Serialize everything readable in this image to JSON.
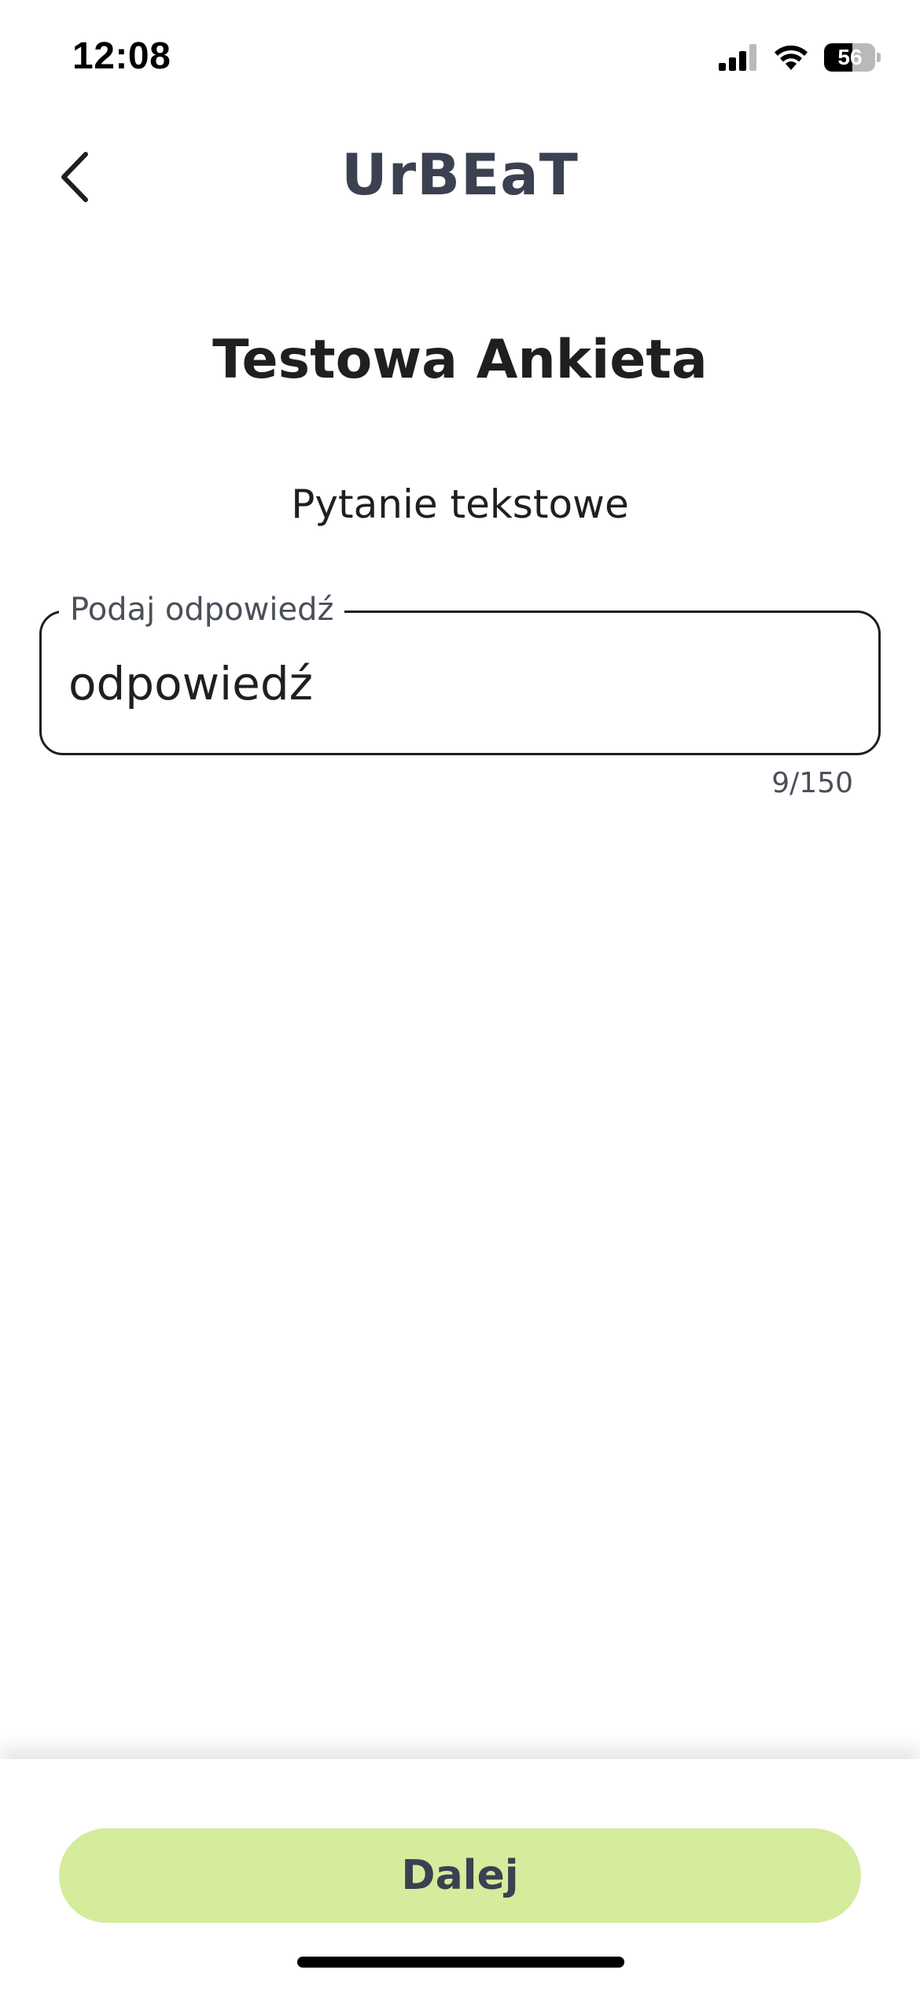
{
  "status_bar": {
    "time": "12:08",
    "battery_percent": 56,
    "battery_label": "56",
    "icons": [
      "signal-icon",
      "wifi-icon",
      "battery-icon"
    ]
  },
  "header": {
    "app_title": "UrBEaT",
    "back_icon": "chevron-left-icon"
  },
  "survey": {
    "title": "Testowa Ankieta",
    "question": "Pytanie tekstowe",
    "answer_label": "Podaj odpowiedź",
    "answer_value": "odpowiedź",
    "char_counter": "9/150"
  },
  "footer": {
    "next_label": "Dalej"
  },
  "colors": {
    "accent_button": "#d5ec9c",
    "title_text": "#3b4150",
    "body_text": "#1f1f22"
  }
}
